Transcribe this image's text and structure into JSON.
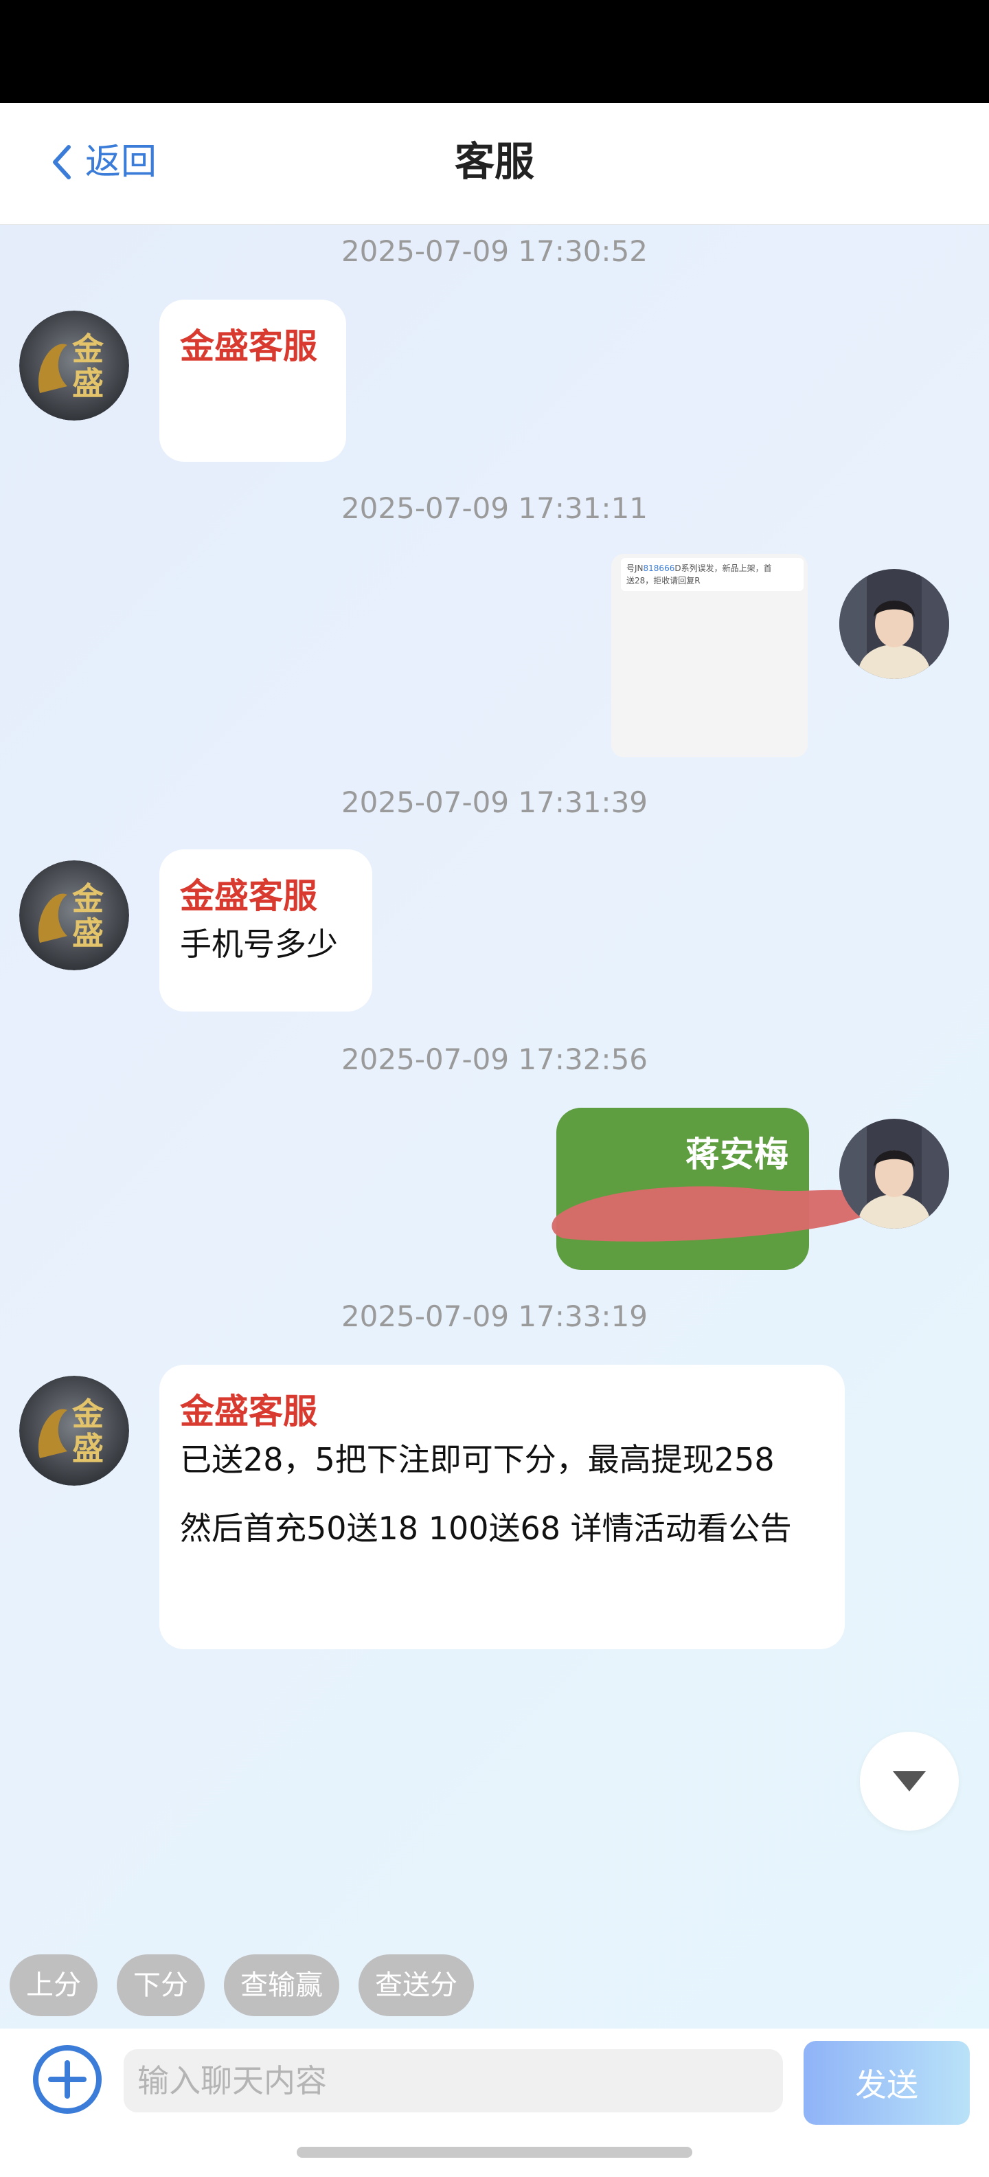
{
  "header": {
    "back_label": "返回",
    "title": "客服"
  },
  "messages": [
    {
      "timestamp": "2025-07-09 17:30:52",
      "side": "left",
      "sender": "金盛客服",
      "lines": []
    },
    {
      "timestamp": "2025-07-09 17:31:11",
      "side": "right",
      "type": "image",
      "image_text": [
        "号JN",
        "818666",
        "D系列误发，新品上架，首",
        "送28，拒收请回复R"
      ]
    },
    {
      "timestamp": "2025-07-09 17:31:39",
      "side": "left",
      "sender": "金盛客服",
      "lines": [
        "手机号多少"
      ]
    },
    {
      "timestamp": "2025-07-09 17:32:56",
      "side": "right",
      "type": "text",
      "name": "蒋安梅",
      "redacted": true
    },
    {
      "timestamp": "2025-07-09 17:33:19",
      "side": "left",
      "sender": "金盛客服",
      "lines": [
        "已送28，5把下注即可下分，最高提现258",
        "然后首充50送18   100送68 详情活动看公告"
      ]
    }
  ],
  "agent_avatar_chars": [
    "金",
    "盛"
  ],
  "quick_actions": [
    "上分",
    "下分",
    "查输赢",
    "查送分"
  ],
  "composer": {
    "placeholder": "输入聊天内容",
    "send_label": "发送"
  },
  "colors": {
    "accent": "#3a7cd8",
    "sender_name": "#d93a2f",
    "user_bubble": "#5f9e40",
    "redaction": "#d86a6a",
    "chip_bg": "#bfbfbf"
  },
  "icons": [
    "chevron-left-icon",
    "chevron-down-icon",
    "plus-circle-icon"
  ]
}
